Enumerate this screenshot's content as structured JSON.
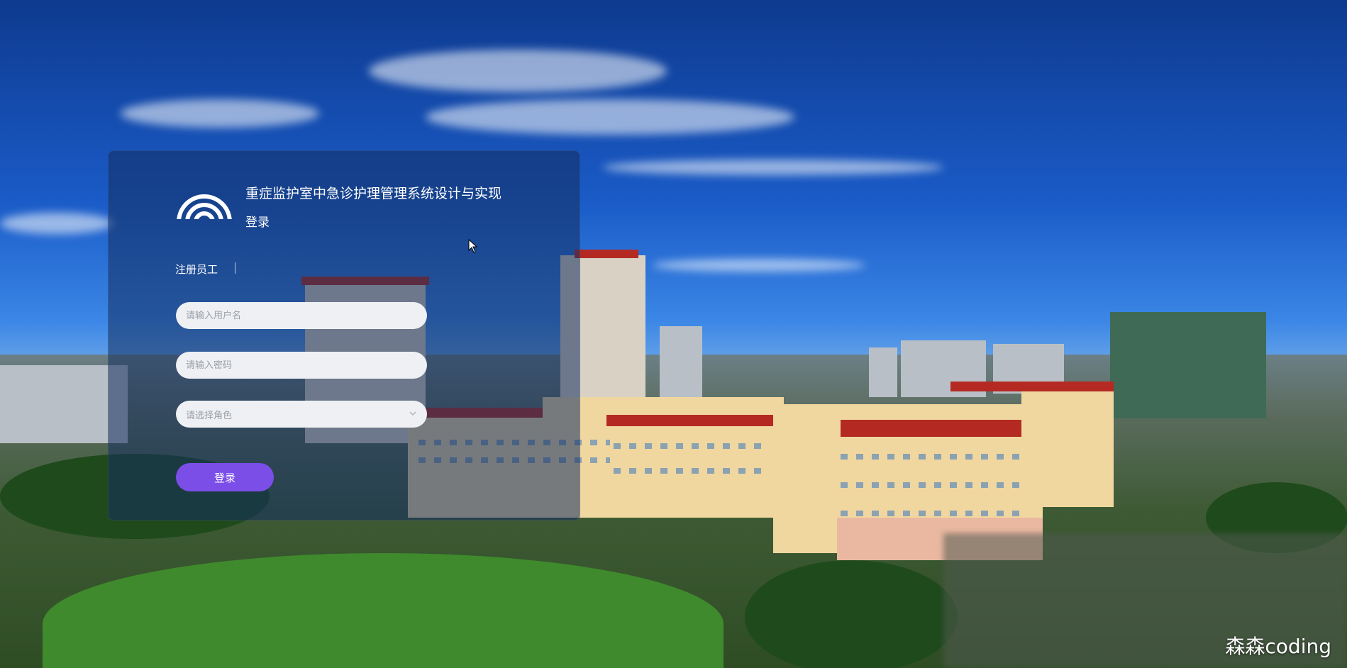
{
  "app": {
    "system_title": "重症监护室中急诊护理管理系统设计与实现",
    "subtitle": "登录",
    "register_link": "注册员工"
  },
  "form": {
    "username_placeholder": "请输入用户名",
    "password_placeholder": "请输入密码",
    "role_placeholder": "请选择角色",
    "login_button": "登录"
  },
  "overlay": {
    "watermark": "森森coding"
  },
  "colors": {
    "accent": "#7c4ee8",
    "card": "#142d5f",
    "input_bg": "#eef0f3"
  },
  "icons": {
    "logo": "wifi-arcs-logo",
    "role_dropdown": "chevron-down-icon",
    "cursor": "pointer-cursor-icon"
  }
}
